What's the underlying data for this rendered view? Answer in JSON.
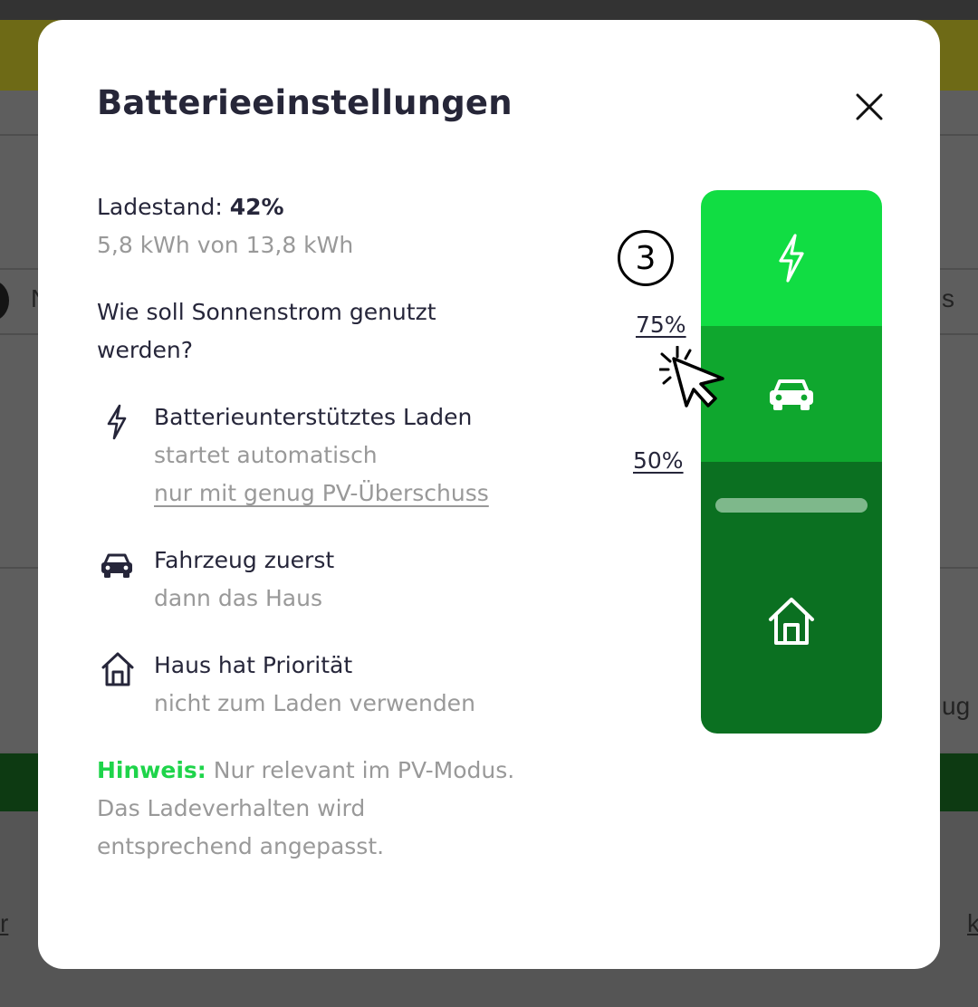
{
  "modal": {
    "title": "Batterieeinstellungen",
    "close_icon": "close-icon"
  },
  "charge": {
    "label": "Ladestand:",
    "value": "42%",
    "energy": "5,8 kWh von 13,8 kWh"
  },
  "question": {
    "line1": "Wie soll Sonnenstrom genutzt",
    "line2": "werden?"
  },
  "options": [
    {
      "icon": "lightning-icon",
      "title": "Batterieunterstütztes Laden",
      "sub1": "startet automatisch",
      "sub2": "nur mit genug PV-Überschuss"
    },
    {
      "icon": "car-icon",
      "title": "Fahrzeug zuerst",
      "sub1": "dann das Haus"
    },
    {
      "icon": "house-icon",
      "title": "Haus hat Priorität",
      "sub1": "nicht zum Laden verwenden"
    }
  ],
  "hint": {
    "label": "Hinweis:",
    "line1": "Nur relevant im PV-Modus.",
    "line2": "Das Ladeverhalten wird",
    "line3": "entsprechend angepasst."
  },
  "battery": {
    "step_badge": "3",
    "threshold_upper": "75%",
    "threshold_lower": "50%",
    "charge_level": 0.42,
    "colors": {
      "top": "#11dd43",
      "middle": "#0fa72e",
      "bottom": "#0b7021"
    }
  },
  "background": {
    "left_fragment": "N",
    "right_fragment_1": "s",
    "right_fragment_2": "ug",
    "bottom_left_link": "r",
    "bottom_right_link": "k"
  }
}
